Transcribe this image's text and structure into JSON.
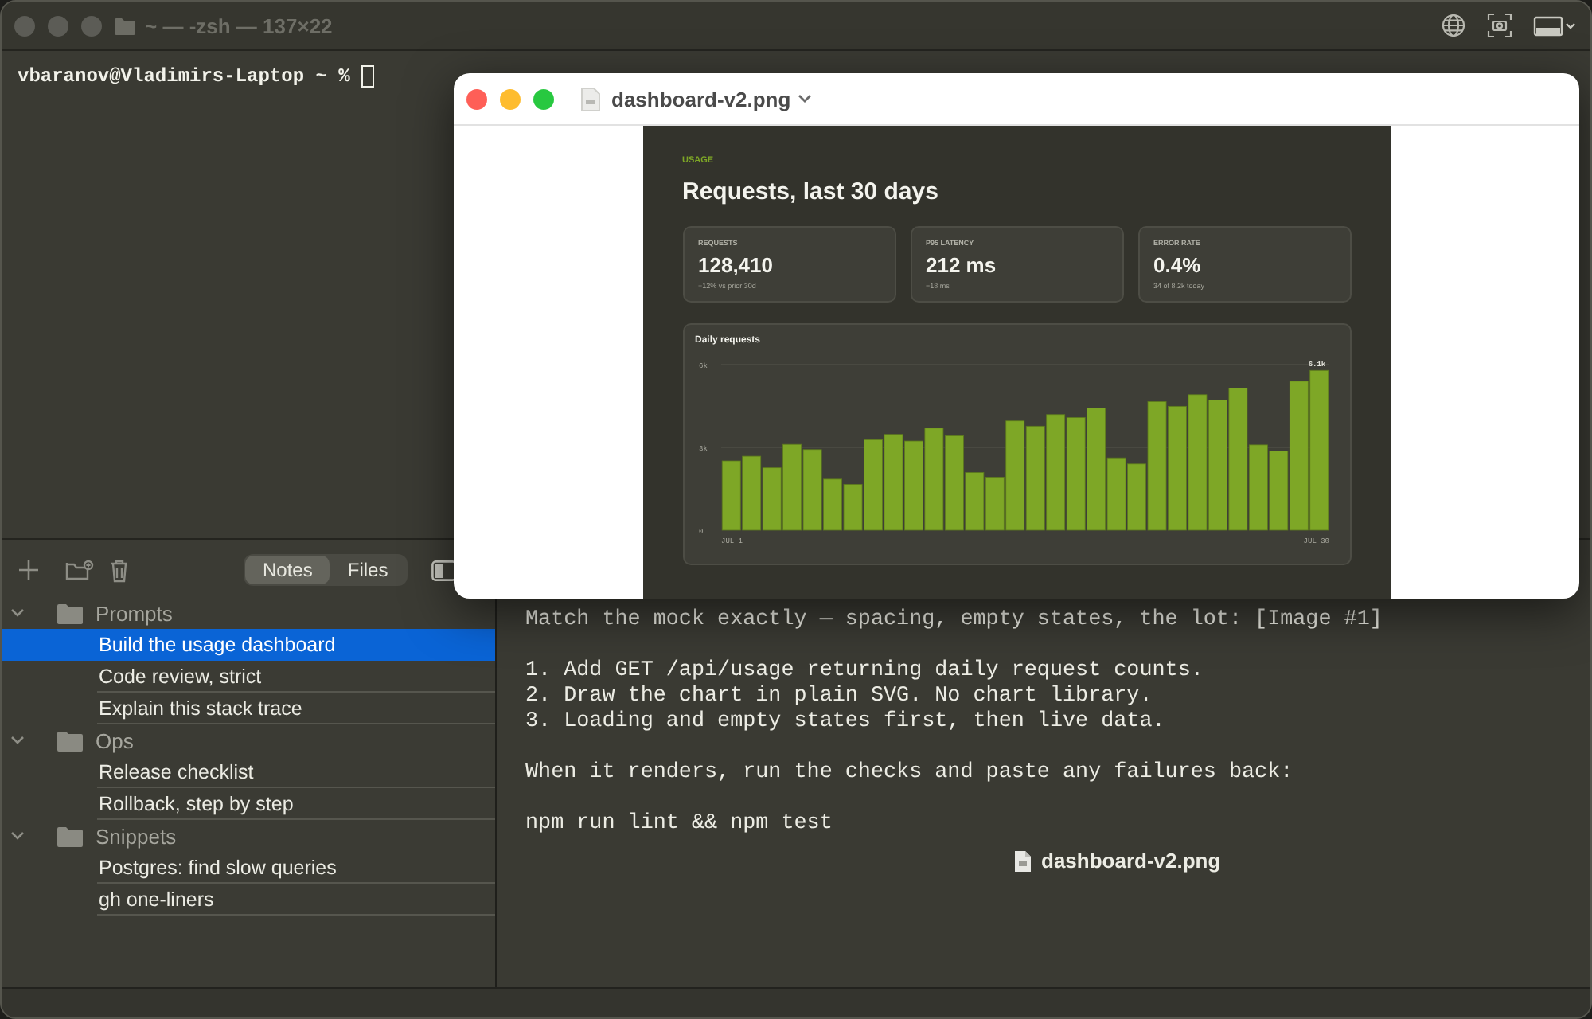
{
  "window": {
    "title": "~ — -zsh — 137×22"
  },
  "terminal": {
    "prompt": "vbaranov@Vladimirs-Laptop ~ %"
  },
  "sidebar": {
    "tabs": [
      {
        "label": "Notes",
        "selected": true
      },
      {
        "label": "Files",
        "selected": false
      }
    ],
    "groups": [
      {
        "label": "Prompts",
        "expanded": true,
        "children": [
          {
            "label": "Build the usage dashboard",
            "selected": true
          },
          {
            "label": "Code review, strict",
            "selected": false
          },
          {
            "label": "Explain this stack trace",
            "selected": false
          }
        ]
      },
      {
        "label": "Ops",
        "expanded": true,
        "children": [
          {
            "label": "Release checklist",
            "selected": false
          },
          {
            "label": "Rollback, step by step",
            "selected": false
          }
        ]
      },
      {
        "label": "Snippets",
        "expanded": true,
        "children": [
          {
            "label": "Postgres: find slow queries",
            "selected": false
          },
          {
            "label": "gh one-liners",
            "selected": false
          }
        ]
      }
    ]
  },
  "prompt_pane": {
    "paragraphs": [
      [
        "Match the mock exactly — spacing, empty states, the lot: [Image #1]"
      ],
      [
        "1. Add GET /api/usage returning daily request counts.",
        "2. Draw the chart in plain SVG. No chart library.",
        "3. Loading and empty states first, then live data."
      ],
      [
        "When it renders, run the checks and paste any failures back:"
      ],
      [
        "npm run lint && npm test"
      ]
    ],
    "attachment": {
      "name": "dashboard-v2.png"
    }
  },
  "preview": {
    "title": "dashboard-v2.png",
    "image": {
      "eyebrow": "USAGE",
      "heading": "Requests, last 30 days",
      "stats": [
        {
          "label": "REQUESTS",
          "value": "128,410",
          "note": "+12% vs prior 30d"
        },
        {
          "label": "P95 LATENCY",
          "value": "212 ms",
          "note": "−18 ms"
        },
        {
          "label": "ERROR RATE",
          "value": "0.4%",
          "note": "34 of 8.2k today"
        }
      ],
      "chart_data": {
        "type": "bar",
        "title": "Daily requests",
        "categories": [
          "JUL 1",
          null,
          null,
          null,
          null,
          null,
          null,
          null,
          null,
          null,
          null,
          null,
          null,
          null,
          null,
          null,
          null,
          null,
          null,
          null,
          null,
          null,
          null,
          null,
          null,
          null,
          null,
          null,
          null,
          "JUL 30"
        ],
        "values": [
          2510,
          2680,
          2260,
          3110,
          2920,
          1850,
          1660,
          3280,
          3470,
          3230,
          3700,
          3420,
          2090,
          1920,
          3960,
          3770,
          4190,
          4080,
          4430,
          2620,
          2400,
          4660,
          4490,
          4910,
          4720,
          5150,
          3090,
          2870,
          5400,
          5790
        ],
        "ylim": [
          0,
          6000
        ],
        "yticks": [
          {
            "value": 0,
            "label": "0"
          },
          {
            "value": 3000,
            "label": "3k"
          },
          {
            "value": 6000,
            "label": "6k"
          }
        ],
        "annotations": [
          {
            "x": "JUL 30",
            "y": 5790,
            "text": "6.1k"
          }
        ]
      }
    }
  }
}
